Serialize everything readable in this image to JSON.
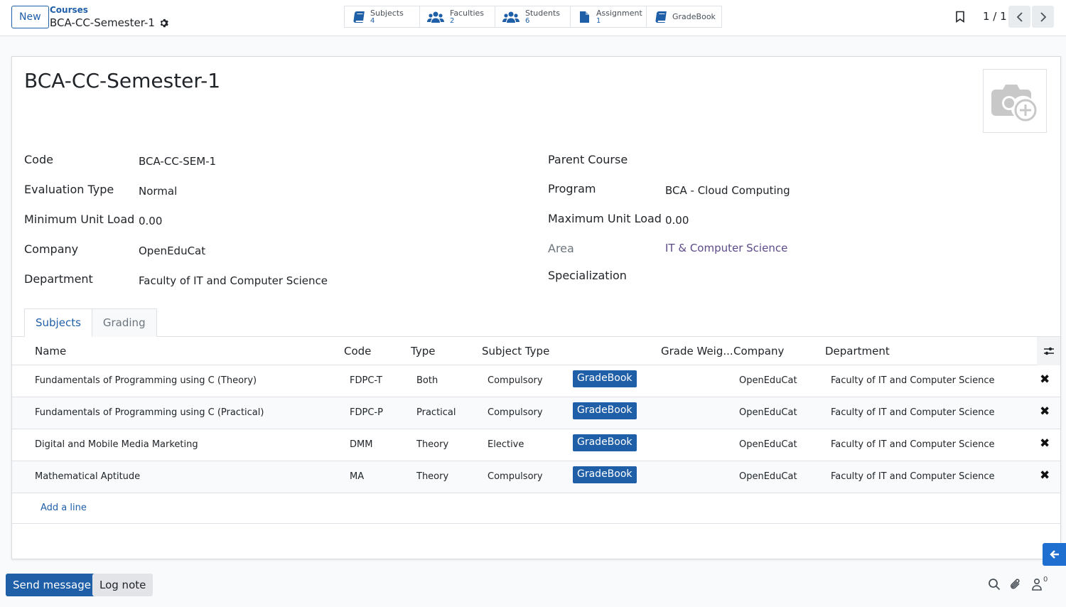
{
  "topbar": {
    "new_label": "New",
    "breadcrumb_parent": "Courses",
    "breadcrumb_current": "BCA-CC-Semester-1",
    "pager": "1 / 1"
  },
  "smart_buttons": [
    {
      "label": "Subjects",
      "count": "4",
      "icon": "book-icon"
    },
    {
      "label": "Faculties",
      "count": "2",
      "icon": "users-icon"
    },
    {
      "label": "Students",
      "count": "6",
      "icon": "users-icon"
    },
    {
      "label": "Assignment",
      "count": "1",
      "icon": "file-icon"
    },
    {
      "label": "GradeBook",
      "count": "",
      "icon": "book-icon"
    }
  ],
  "record": {
    "title": "BCA-CC-Semester-1",
    "left_fields": [
      {
        "label": "Code",
        "value": "BCA-CC-SEM-1"
      },
      {
        "label": "Evaluation Type",
        "value": "Normal"
      },
      {
        "label": "Minimum Unit Load",
        "value": "0.00"
      },
      {
        "label": "Company",
        "value": "OpenEduCat"
      },
      {
        "label": "Department",
        "value": "Faculty of IT and Computer Science"
      }
    ],
    "right_fields": [
      {
        "label": "Parent Course",
        "value": ""
      },
      {
        "label": "Program",
        "value": "BCA - Cloud Computing"
      },
      {
        "label": "Maximum Unit Load",
        "value": "0.00"
      },
      {
        "label": "Area",
        "value": "IT & Computer Science"
      },
      {
        "label": "Specialization",
        "value": ""
      }
    ]
  },
  "tabs": [
    "Subjects",
    "Grading"
  ],
  "table": {
    "columns": [
      "Name",
      "Code",
      "Type",
      "Subject Type",
      "Grade Weig...",
      "Company",
      "Department"
    ],
    "gradebook_label": "GradeBook",
    "rows": [
      {
        "name": "Fundamentals of Programming using C (Theory)",
        "code": "FDPC-T",
        "type": "Both",
        "subject_type": "Compulsory",
        "company": "OpenEduCat",
        "department": "Faculty of IT and Computer Science"
      },
      {
        "name": "Fundamentals of Programming using C (Practical)",
        "code": "FDPC-P",
        "type": "Practical",
        "subject_type": "Compulsory",
        "company": "OpenEduCat",
        "department": "Faculty of IT and Computer Science"
      },
      {
        "name": "Digital and Mobile Media Marketing",
        "code": "DMM",
        "type": "Theory",
        "subject_type": "Elective",
        "company": "OpenEduCat",
        "department": "Faculty of IT and Computer Science"
      },
      {
        "name": "Mathematical Aptitude",
        "code": "MA",
        "type": "Theory",
        "subject_type": "Compulsory",
        "company": "OpenEduCat",
        "department": "Faculty of IT and Computer Science"
      }
    ],
    "add_line": "Add a line"
  },
  "chatter": {
    "send_message": "Send message",
    "log_note": "Log note",
    "followers_count": "0"
  },
  "colors": {
    "accent": "#1f5fa8",
    "link_purple": "#5d4a8a"
  }
}
